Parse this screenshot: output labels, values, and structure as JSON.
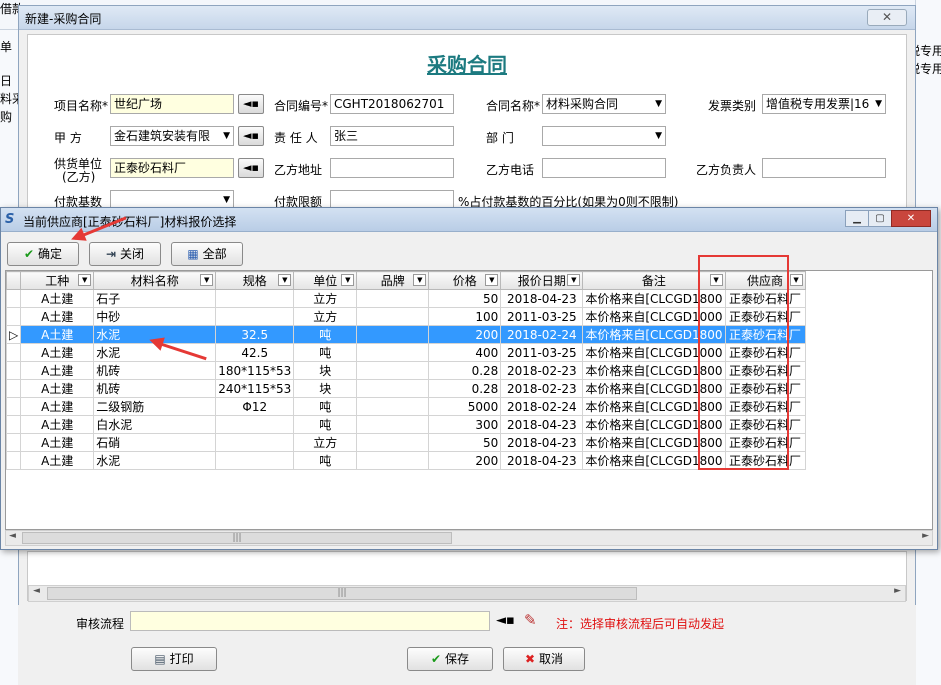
{
  "background": {
    "top_texts": [
      "单",
      "借款",
      "日",
      "料采",
      "购"
    ],
    "right_texts": [
      "税专用",
      "税专用"
    ]
  },
  "dialog": {
    "title": "新建-采购合同",
    "contract_title": "采购合同",
    "fields": {
      "project_label": "项目名称*",
      "project_value": "世纪广场",
      "contract_no_label": "合同编号*",
      "contract_no_value": "CGHT2018062701",
      "contract_name_label": "合同名称*",
      "contract_name_value": "材料采购合同",
      "invoice_label": "发票类别",
      "invoice_value": "增值税专用发票|16",
      "party_a_label": "甲 方",
      "party_a_value": "金石建筑安装有限",
      "responsible_label": "责 任 人",
      "responsible_value": "张三",
      "dept_label": "部 门",
      "dept_value": "",
      "supplier_label": "供货单位",
      "supplier_label2": "(乙方)",
      "supplier_value": "正泰砂石料厂",
      "party_b_address_label": "乙方地址",
      "party_b_phone_label": "乙方电话",
      "party_b_contact_label": "乙方负责人",
      "pay_base_label": "付款基数",
      "pay_limit_label": "付款限额",
      "pay_note": "%占付款基数的百分比(如果为0则不限制)"
    },
    "audit_label": "审核流程",
    "audit_note": "注：选择审核流程后可自动发起",
    "buttons": {
      "print": "打印",
      "save": "保存",
      "cancel": "取消"
    }
  },
  "popup": {
    "title": "当前供应商[正泰砂石料厂]材料报价选择",
    "buttons": {
      "confirm": "确定",
      "close": "关闭",
      "all": "全部"
    },
    "columns": [
      "工种",
      "材料名称",
      "规格",
      "单位",
      "品牌",
      "价格",
      "报价日期",
      "备注",
      "供应商"
    ],
    "rows": [
      [
        "A土建",
        "石子",
        "",
        "立方",
        "",
        "50",
        "2018-04-23",
        "本价格来自[CLCGD1800",
        "正泰砂石料厂"
      ],
      [
        "A土建",
        "中砂",
        "",
        "立方",
        "",
        "100",
        "2011-03-25",
        "本价格来自[CLCGD1000",
        "正泰砂石料厂"
      ],
      [
        "A土建",
        "水泥",
        "32.5",
        "吨",
        "",
        "200",
        "2018-02-24",
        "本价格来自[CLCGD1800",
        "正泰砂石料厂"
      ],
      [
        "A土建",
        "水泥",
        "42.5",
        "吨",
        "",
        "400",
        "2011-03-25",
        "本价格来自[CLCGD1000",
        "正泰砂石料厂"
      ],
      [
        "A土建",
        "机砖",
        "180*115*53",
        "块",
        "",
        "0.28",
        "2018-02-23",
        "本价格来自[CLCGD1800",
        "正泰砂石料厂"
      ],
      [
        "A土建",
        "机砖",
        "240*115*53",
        "块",
        "",
        "0.28",
        "2018-02-23",
        "本价格来自[CLCGD1800",
        "正泰砂石料厂"
      ],
      [
        "A土建",
        "二级钢筋",
        "Φ12",
        "吨",
        "",
        "5000",
        "2018-02-24",
        "本价格来自[CLCGD1800",
        "正泰砂石料厂"
      ],
      [
        "A土建",
        "白水泥",
        "",
        "吨",
        "",
        "300",
        "2018-04-23",
        "本价格来自[CLCGD1800",
        "正泰砂石料厂"
      ],
      [
        "A土建",
        "石硝",
        "",
        "立方",
        "",
        "50",
        "2018-04-23",
        "本价格来自[CLCGD1800",
        "正泰砂石料厂"
      ],
      [
        "A土建",
        "水泥",
        "",
        "吨",
        "",
        "200",
        "2018-04-23",
        "本价格来自[CLCGD1800",
        "正泰砂石料厂"
      ]
    ],
    "selected_row": 2
  }
}
